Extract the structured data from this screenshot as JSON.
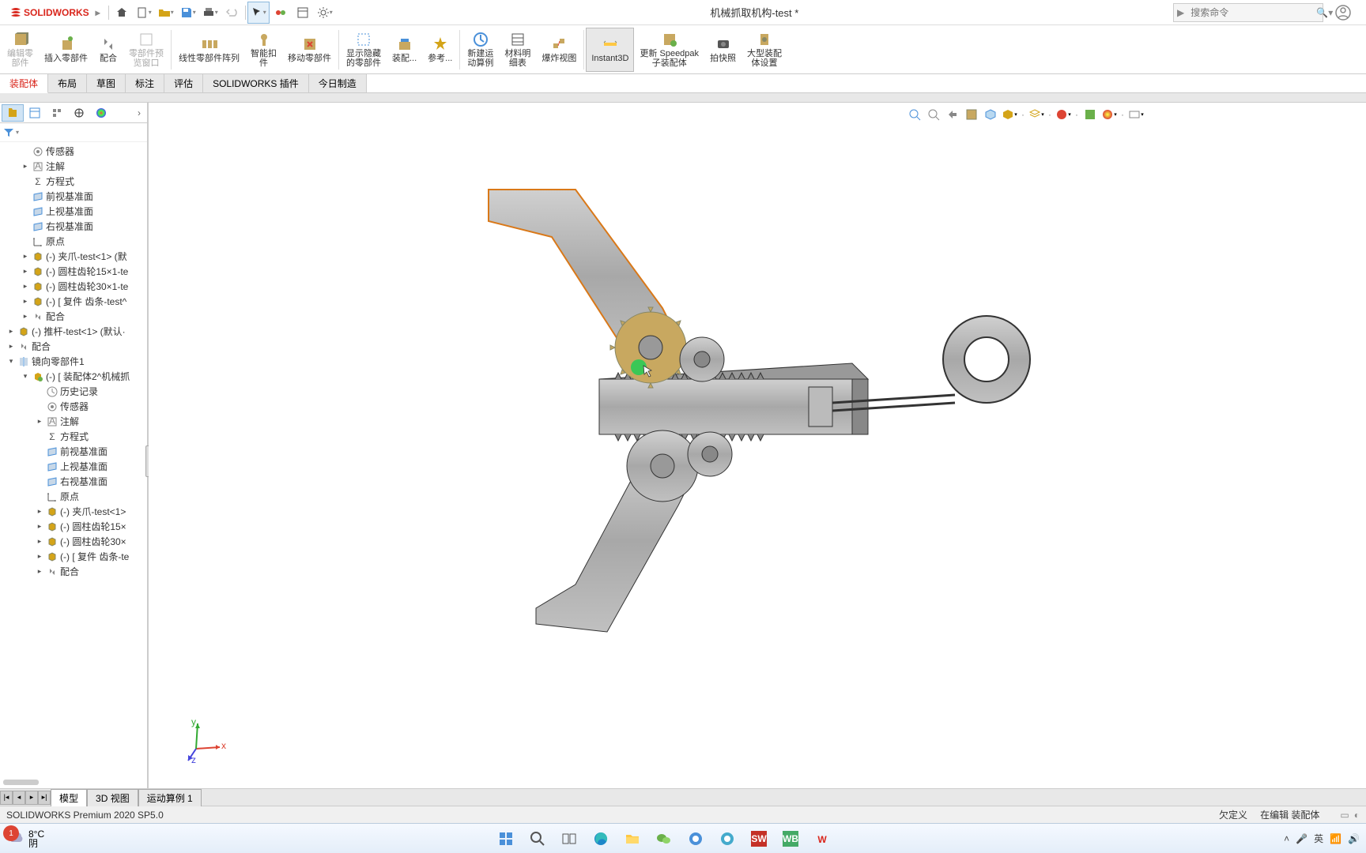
{
  "app": {
    "name": "SOLIDWORKS",
    "doc_title": "机械抓取机构-test *"
  },
  "search": {
    "placeholder": "搜索命令"
  },
  "ribbon": {
    "items": [
      {
        "label": "编辑零\n部件",
        "disabled": true
      },
      {
        "label": "插入零部件"
      },
      {
        "label": "配合"
      },
      {
        "label": "零部件预\n览窗口",
        "disabled": true
      },
      {
        "label": "线性零部件阵列"
      },
      {
        "label": "智能扣\n件"
      },
      {
        "label": "移动零部件"
      },
      {
        "label": "显示隐藏\n的零部件"
      },
      {
        "label": "装配..."
      },
      {
        "label": "参考..."
      },
      {
        "label": "新建运\n动算例"
      },
      {
        "label": "材料明\n细表"
      },
      {
        "label": "爆炸视图"
      },
      {
        "label": "Instant3D",
        "active": true
      },
      {
        "label": "更新 Speedpak\n子装配体"
      },
      {
        "label": "拍快照"
      },
      {
        "label": "大型装配\n体设置"
      }
    ]
  },
  "cmdtabs": [
    "装配体",
    "布局",
    "草图",
    "标注",
    "评估",
    "SOLIDWORKS 插件",
    "今日制造"
  ],
  "cmdtab_active": 0,
  "tree": [
    {
      "indent": 1,
      "icon": "sensor",
      "label": "传感器"
    },
    {
      "indent": 1,
      "icon": "annot",
      "label": "注解",
      "arrow": "▸"
    },
    {
      "indent": 1,
      "icon": "eqn",
      "label": "方程式"
    },
    {
      "indent": 1,
      "icon": "plane",
      "label": "前视基准面"
    },
    {
      "indent": 1,
      "icon": "plane",
      "label": "上视基准面"
    },
    {
      "indent": 1,
      "icon": "plane",
      "label": "右视基准面"
    },
    {
      "indent": 1,
      "icon": "origin",
      "label": "原点"
    },
    {
      "indent": 1,
      "icon": "part",
      "label": "(-) 夹爪-test<1> (默",
      "arrow": "▸"
    },
    {
      "indent": 1,
      "icon": "part",
      "label": "(-) 圆柱齿轮15×1-te",
      "arrow": "▸"
    },
    {
      "indent": 1,
      "icon": "part",
      "label": "(-) 圆柱齿轮30×1-te",
      "arrow": "▸"
    },
    {
      "indent": 1,
      "icon": "part",
      "label": "(-) [ 复件 齿条-test^",
      "arrow": "▸"
    },
    {
      "indent": 1,
      "icon": "mate",
      "label": "配合",
      "arrow": "▸"
    },
    {
      "indent": 0,
      "icon": "part",
      "label": "(-) 推杆-test<1> (默认·",
      "arrow": "▸"
    },
    {
      "indent": 0,
      "icon": "mate",
      "label": "配合",
      "arrow": "▸"
    },
    {
      "indent": 0,
      "icon": "mirror",
      "label": "镜向零部件1",
      "arrow": "▾"
    },
    {
      "indent": 1,
      "icon": "asm",
      "label": "(-) [ 装配体2^机械抓",
      "arrow": "▾"
    },
    {
      "indent": 2,
      "icon": "hist",
      "label": "历史记录"
    },
    {
      "indent": 2,
      "icon": "sensor",
      "label": "传感器"
    },
    {
      "indent": 2,
      "icon": "annot",
      "label": "注解",
      "arrow": "▸"
    },
    {
      "indent": 2,
      "icon": "eqn",
      "label": "方程式"
    },
    {
      "indent": 2,
      "icon": "plane",
      "label": "前视基准面"
    },
    {
      "indent": 2,
      "icon": "plane",
      "label": "上视基准面"
    },
    {
      "indent": 2,
      "icon": "plane",
      "label": "右视基准面"
    },
    {
      "indent": 2,
      "icon": "origin",
      "label": "原点"
    },
    {
      "indent": 2,
      "icon": "part",
      "label": "(-) 夹爪-test<1>",
      "arrow": "▸"
    },
    {
      "indent": 2,
      "icon": "part",
      "label": "(-) 圆柱齿轮15×",
      "arrow": "▸"
    },
    {
      "indent": 2,
      "icon": "part",
      "label": "(-) 圆柱齿轮30×",
      "arrow": "▸"
    },
    {
      "indent": 2,
      "icon": "part",
      "label": "(-) [ 复件 齿条-te",
      "arrow": "▸"
    },
    {
      "indent": 2,
      "icon": "mate",
      "label": "配合",
      "arrow": "▸"
    }
  ],
  "view_tabs": [
    "模型",
    "3D 视图",
    "运动算例 1"
  ],
  "view_tab_active": 0,
  "status": {
    "product": "SOLIDWORKS Premium 2020 SP5.0",
    "right1": "欠定义",
    "right2": "在编辑 装配体"
  },
  "weather": {
    "temp": "8°C",
    "cond": "阴",
    "badge": "1"
  },
  "triad_labels": {
    "x": "x",
    "y": "y",
    "z": "z"
  }
}
